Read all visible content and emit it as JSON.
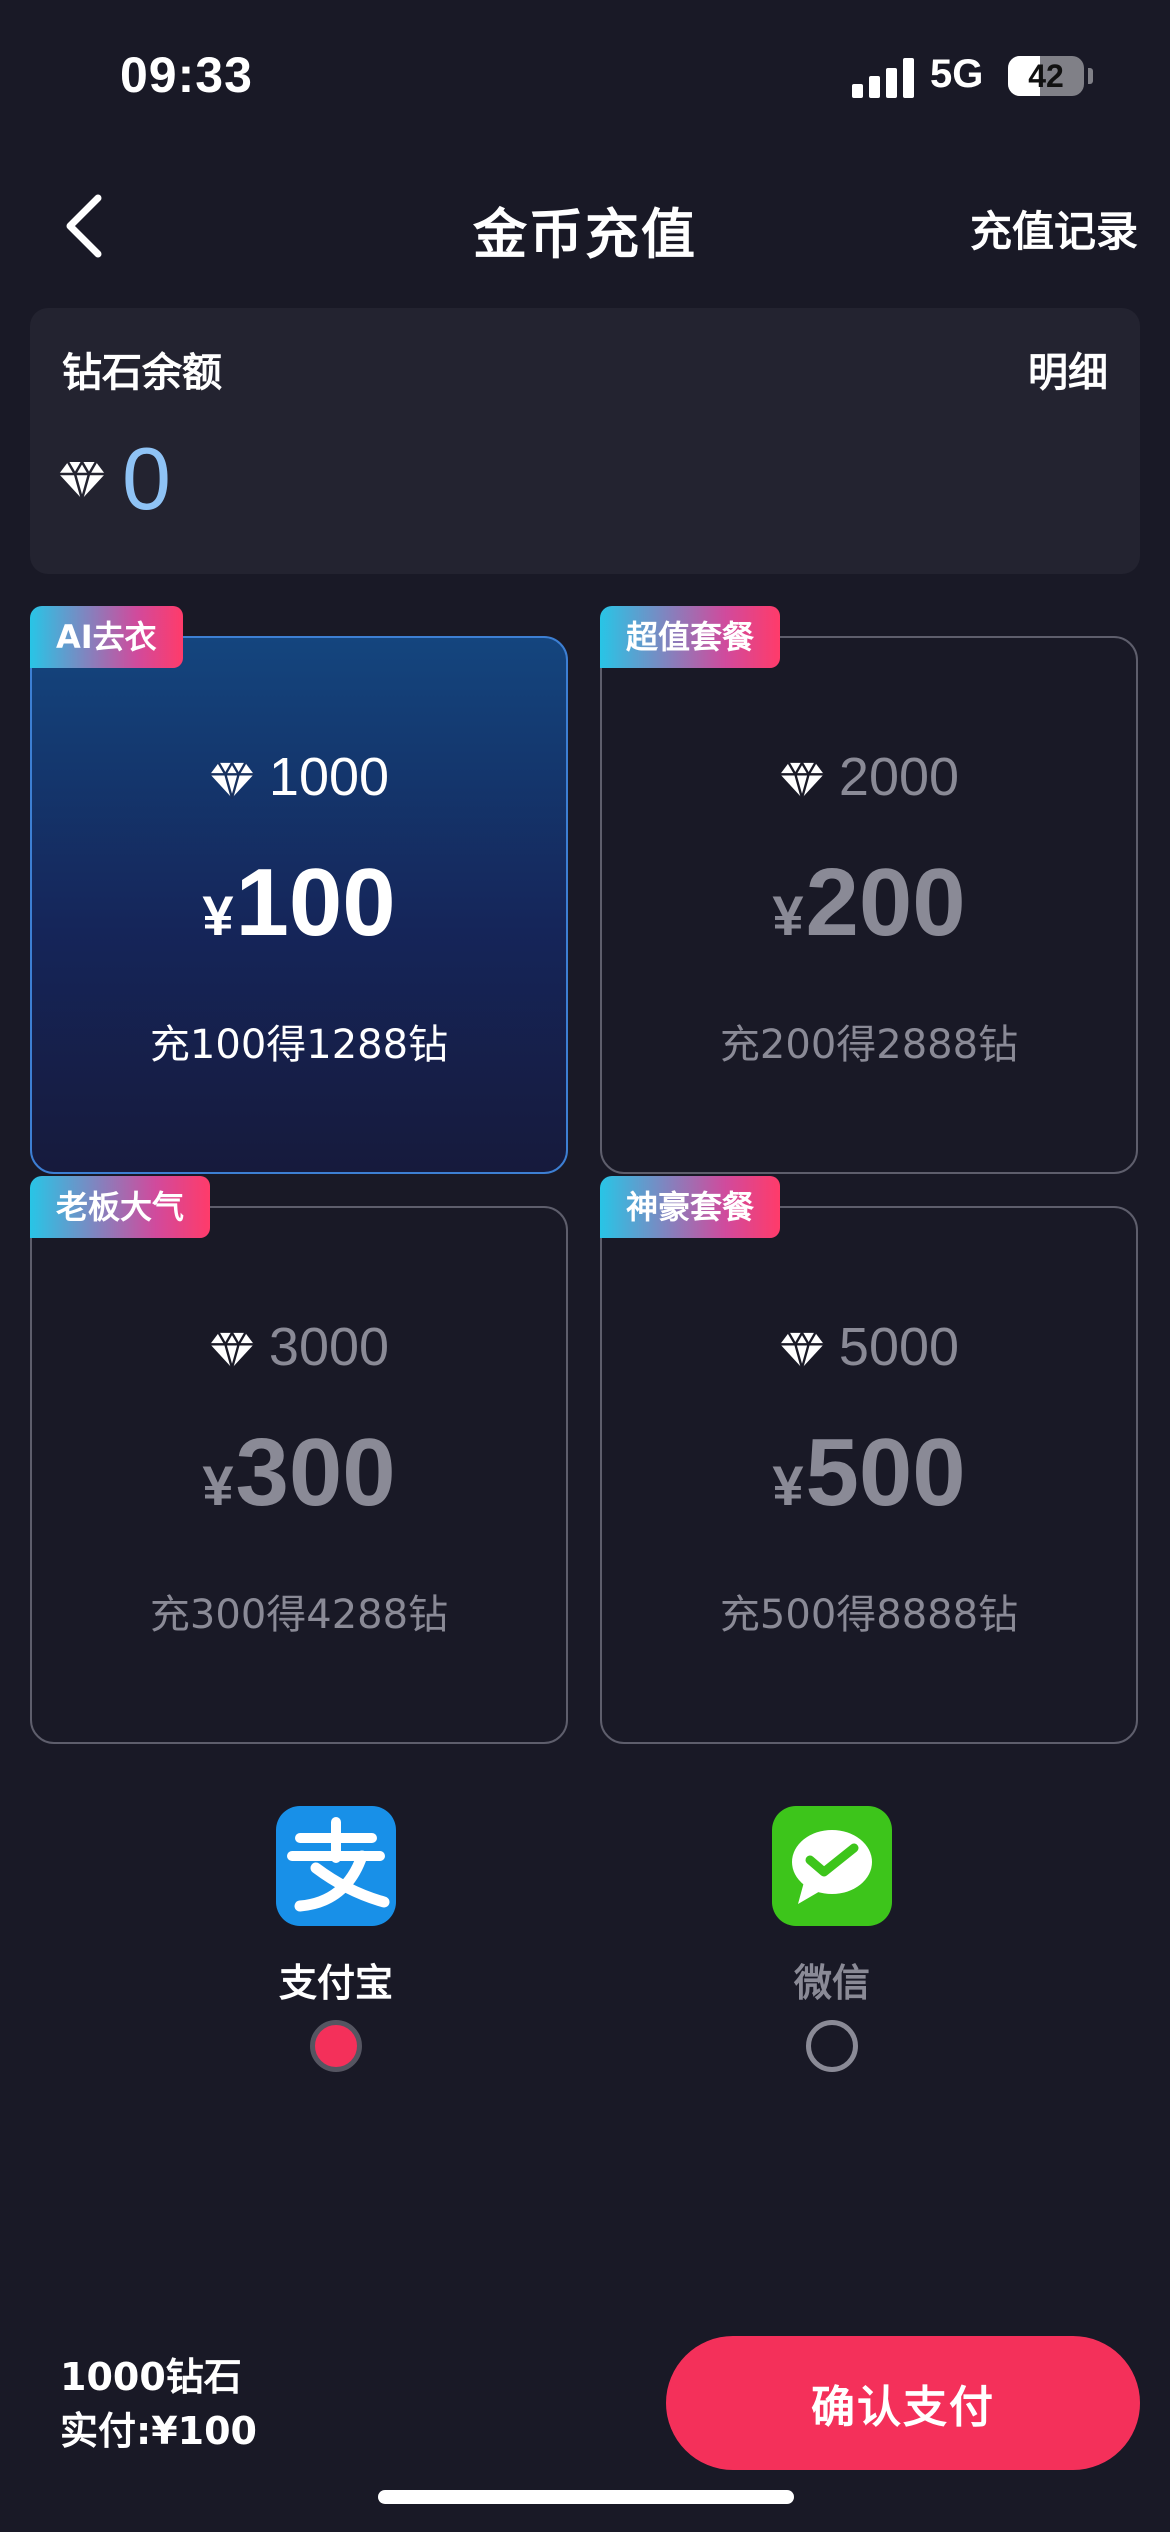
{
  "status_bar": {
    "time": "09:33",
    "network": "5G",
    "battery": "42",
    "battery_level": 0.42
  },
  "header": {
    "title": "金币充值",
    "history_link": "充值记录"
  },
  "balance": {
    "label": "钻石余额",
    "detail_link": "明细",
    "value": "0"
  },
  "packages": [
    {
      "tag": "AI去衣",
      "gems": "1000",
      "yen": "¥",
      "price": "100",
      "bonus": "充100得1288钻",
      "selected": true
    },
    {
      "tag": "超值套餐",
      "gems": "2000",
      "yen": "¥",
      "price": "200",
      "bonus": "充200得2888钻",
      "selected": false
    },
    {
      "tag": "老板大气",
      "gems": "3000",
      "yen": "¥",
      "price": "300",
      "bonus": "充300得4288钻",
      "selected": false
    },
    {
      "tag": "神豪套餐",
      "gems": "5000",
      "yen": "¥",
      "price": "500",
      "bonus": "充500得8888钻",
      "selected": false
    }
  ],
  "payment_methods": [
    {
      "label": "支付宝",
      "icon": "alipay-icon",
      "color": "#1890e8",
      "selected": true
    },
    {
      "label": "微信",
      "icon": "wechat-pay-icon",
      "color": "#3dc51b",
      "selected": false
    }
  ],
  "summary": {
    "gems": "1000钻石",
    "paid": "实付:¥100"
  },
  "confirm_button": "确认支付",
  "colors": {
    "background": "#191926",
    "accent": "#f4305a",
    "balance_value": "#8fc3f5",
    "selected_border": "#3d7fd3"
  }
}
